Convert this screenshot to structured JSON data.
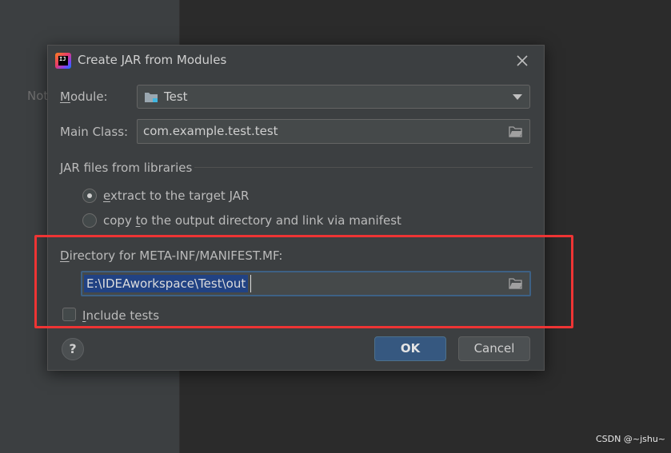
{
  "background": {
    "left_text": "Not"
  },
  "dialog": {
    "title": "Create JAR from Modules",
    "module": {
      "label_first": "M",
      "label_rest": "odule:",
      "value": "Test"
    },
    "main_class": {
      "label": "Main Class:",
      "value": "com.example.test.test"
    },
    "jar_libraries": {
      "heading": "JAR files from libraries",
      "options": [
        {
          "mnemonic": "e",
          "rest": "xtract to the target JAR",
          "selected": true
        },
        {
          "pre": "copy ",
          "mnemonic": "t",
          "rest": "o the output directory and link via manifest",
          "selected": false
        }
      ]
    },
    "manifest": {
      "label_first": "D",
      "label_rest": "irectory for META-INF/MANIFEST.MF:",
      "value": "E:\\IDEAworkspace\\Test\\out"
    },
    "include_tests": {
      "label_first": "I",
      "label_rest": "nclude tests",
      "checked": false
    },
    "buttons": {
      "help": "?",
      "ok": "OK",
      "cancel": "Cancel"
    }
  },
  "annotation": {
    "highlight_color": "#ee3434"
  },
  "watermark": "CSDN @~jshu~",
  "colors": {
    "dialog_bg": "#3c3f41",
    "ok_button": "#365880",
    "selection": "#214283"
  }
}
